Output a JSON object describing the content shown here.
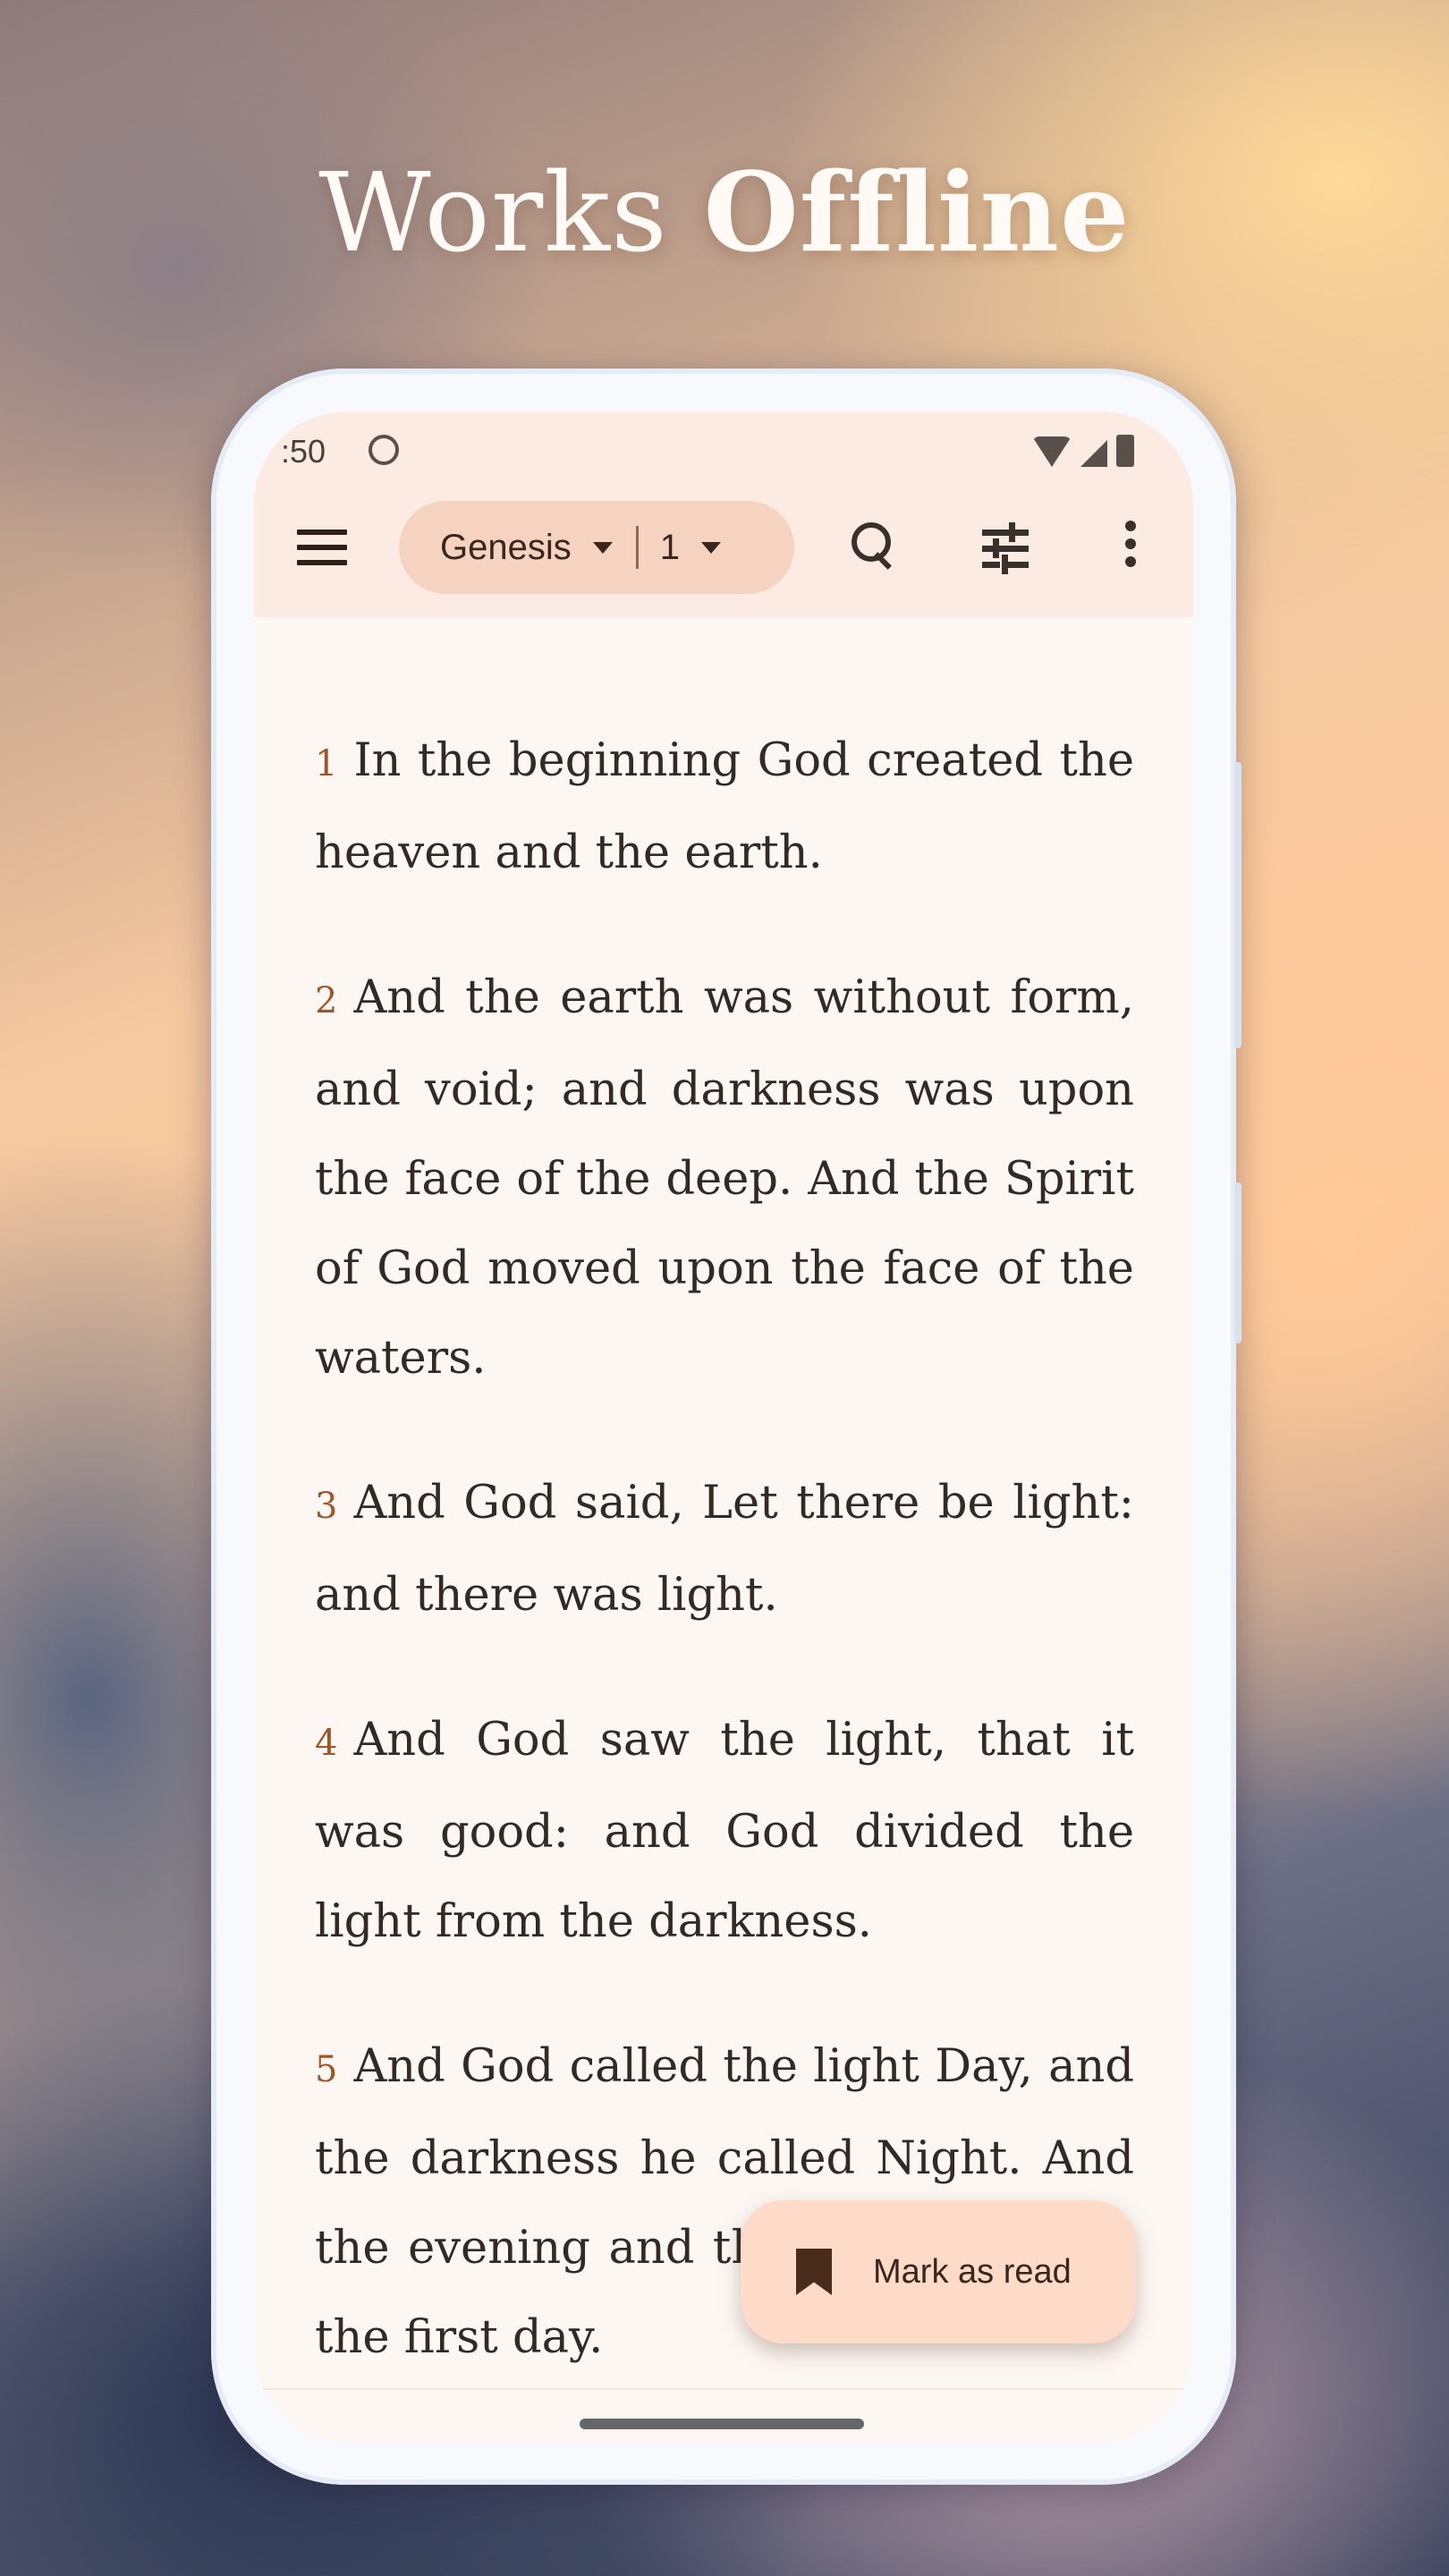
{
  "headline": {
    "part1": "Works ",
    "part2": "Offline"
  },
  "status_bar": {
    "time": ":50",
    "icons": [
      "face-icon",
      "wifi-icon",
      "signal-icon",
      "battery-icon"
    ]
  },
  "toolbar": {
    "menu_icon": "menu-icon",
    "book": "Genesis",
    "chapter": "1",
    "search_icon": "search-icon",
    "tune_icon": "tune-icon",
    "more_icon": "more-vert-icon"
  },
  "verses": [
    {
      "num": "1",
      "text": "In the beginning God created the heaven and the earth."
    },
    {
      "num": "2",
      "text": "And the earth was without form, and void; and darkness was upon the face of the deep. And the Spirit of God moved upon the face of the waters."
    },
    {
      "num": "3",
      "text": "And God said, Let there be light: and there was light."
    },
    {
      "num": "4",
      "text": "And God saw the light, that it was good: and God divided the light from the darkness."
    },
    {
      "num": "5",
      "text": "And God called the light Day, and the darkness he called Night. And the evening and the morning were the first day."
    }
  ],
  "fab": {
    "label": "Mark as read",
    "icon": "bookmark-icon"
  },
  "colors": {
    "accent": "#a0562a",
    "appbar": "#fcebe2",
    "pill": "#f6d3c0",
    "fab": "#fedbc8"
  }
}
